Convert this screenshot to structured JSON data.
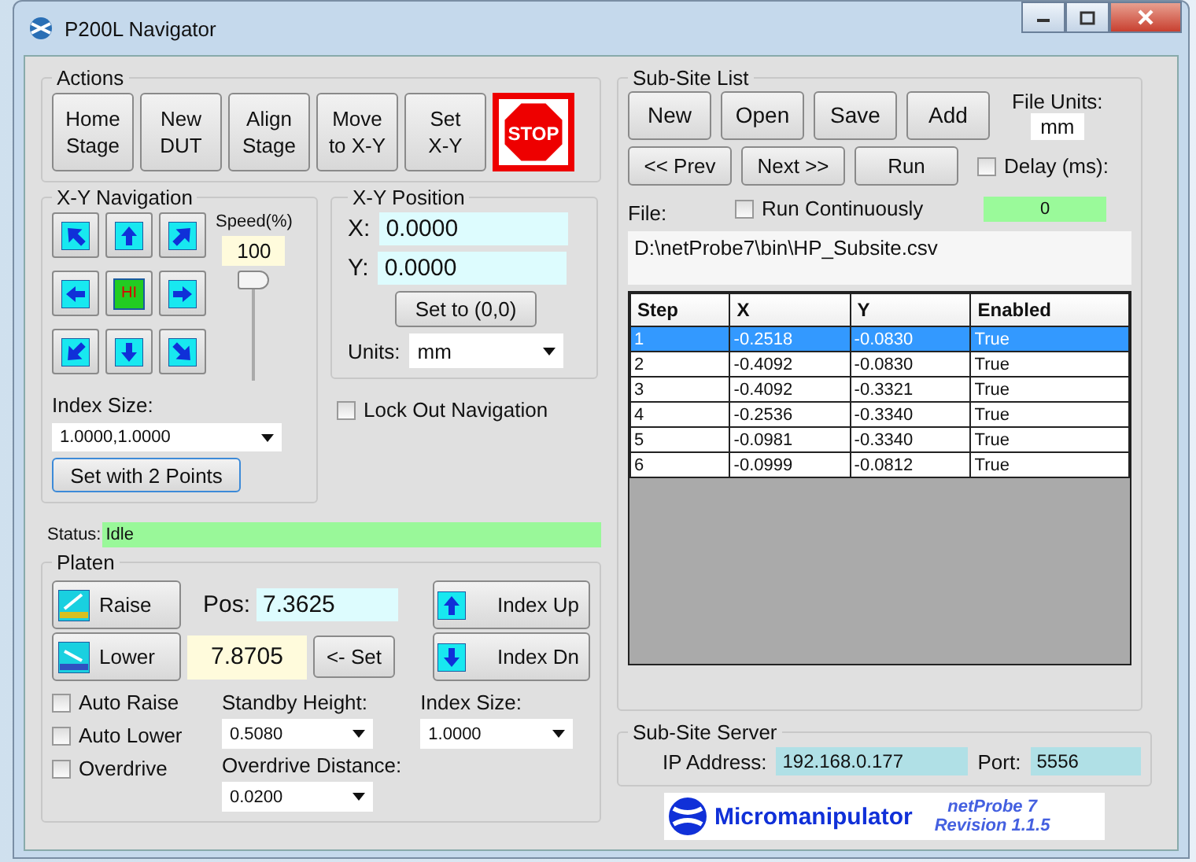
{
  "window": {
    "title": "P200L Navigator"
  },
  "actions": {
    "title": "Actions",
    "buttons": [
      {
        "lines": [
          "Home",
          "Stage"
        ]
      },
      {
        "lines": [
          "New",
          "DUT"
        ]
      },
      {
        "lines": [
          "Align",
          "Stage"
        ]
      },
      {
        "lines": [
          "Move",
          "to X-Y"
        ]
      },
      {
        "lines": [
          "Set",
          "X-Y"
        ]
      }
    ],
    "stop_label": "STOP"
  },
  "xy_navigation": {
    "title": "X-Y Navigation",
    "pad": [
      {
        "kind": "northwest"
      },
      {
        "kind": "north"
      },
      {
        "kind": "northeast"
      },
      {
        "kind": "west"
      },
      {
        "kind": "home",
        "label": "HI"
      },
      {
        "kind": "east"
      },
      {
        "kind": "southwest"
      },
      {
        "kind": "south"
      },
      {
        "kind": "southeast"
      }
    ],
    "speed_label": "Speed(%)",
    "speed_value": "100",
    "speed_slider": {
      "level": 1.0
    },
    "index_size_label": "Index Size:",
    "index_size_value": "1.0000,1.0000",
    "set_button": "Set with 2 Points"
  },
  "xy_position": {
    "title": "X-Y Position",
    "x_label": "X:",
    "x_value": "0.0000",
    "y_label": "Y:",
    "y_value": "0.0000",
    "zero_button": "Set to (0,0)",
    "units_label": "Units:",
    "units_value": "mm"
  },
  "lock_out": {
    "label": "Lock Out Navigation",
    "checked": false
  },
  "status": {
    "label": "Status:",
    "value": "Idle"
  },
  "platen": {
    "title": "Platen",
    "raise_button": "Raise",
    "pos_label": "Pos:",
    "pos_value": "7.3625",
    "index_up_button": "Index Up",
    "lower_button": "Lower",
    "lower_value": "7.8705",
    "set_button": "<- Set",
    "index_dn_button": "Index Dn",
    "checkboxes": [
      {
        "label": "Auto Raise",
        "checked": false
      },
      {
        "label": "Auto Lower",
        "checked": false
      },
      {
        "label": "Overdrive",
        "checked": false
      }
    ],
    "standby_label": "Standby Height:",
    "standby_value": "0.5080",
    "index_size_label": "Index Size:",
    "index_size_value": "1.0000",
    "overdrive_label": "Overdrive Distance:",
    "overdrive_value": "0.0200"
  },
  "sub_site_list": {
    "title": "Sub-Site List",
    "row1_buttons": [
      "New",
      "Open",
      "Save",
      "Add"
    ],
    "file_units_label": "File Units:",
    "file_units_value": "mm",
    "row2_buttons": [
      "<< Prev",
      "Next >>",
      "Run"
    ],
    "delay": {
      "label": "Delay (ms):",
      "checked": false
    },
    "delay_value": "0",
    "run_continuously": {
      "label": "Run Continuously",
      "checked": false
    },
    "file_label": "File:",
    "file_path": "D:\\netProbe7\\bin\\HP_Subsite.csv",
    "table": {
      "columns": [
        "Step",
        "X",
        "Y",
        "Enabled"
      ],
      "rows": [
        {
          "cells": [
            "1",
            "-0.2518",
            "-0.0830",
            "True"
          ],
          "selected": true
        },
        {
          "cells": [
            "2",
            "-0.4092",
            "-0.0830",
            "True"
          ],
          "selected": false
        },
        {
          "cells": [
            "3",
            "-0.4092",
            "-0.3321",
            "True"
          ],
          "selected": false
        },
        {
          "cells": [
            "4",
            "-0.2536",
            "-0.3340",
            "True"
          ],
          "selected": false
        },
        {
          "cells": [
            "5",
            "-0.0981",
            "-0.3340",
            "True"
          ],
          "selected": false
        },
        {
          "cells": [
            "6",
            "-0.0999",
            "-0.0812",
            "True"
          ],
          "selected": false
        }
      ]
    }
  },
  "sub_site_server": {
    "title": "Sub-Site Server",
    "ip_label": "IP Address:",
    "ip_value": "192.168.0.177",
    "port_label": "Port:",
    "port_value": "5556"
  },
  "logo": {
    "brand": "Micromanipulator",
    "product": "netProbe 7",
    "revision": "Revision 1.1.5"
  }
}
